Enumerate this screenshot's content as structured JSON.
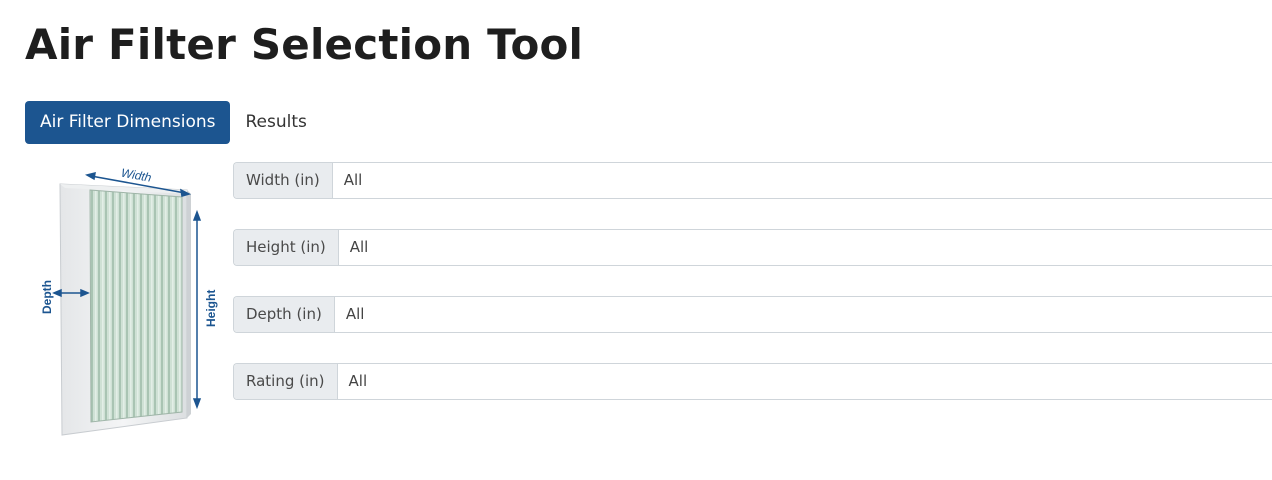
{
  "page": {
    "title": "Air Filter Selection Tool"
  },
  "tabs": [
    {
      "label": "Air Filter Dimensions",
      "active": true
    },
    {
      "label": "Results",
      "active": false
    }
  ],
  "diagram": {
    "width_label": "Width",
    "height_label": "Height",
    "depth_label": "Depth"
  },
  "fields": [
    {
      "label": "Width (in)",
      "value": "All"
    },
    {
      "label": "Height (in)",
      "value": "All"
    },
    {
      "label": "Depth (in)",
      "value": "All"
    },
    {
      "label": "Rating (in)",
      "value": "All"
    }
  ],
  "colors": {
    "accent": "#1c5590",
    "label_bg": "#e9ecef",
    "border": "#cfd5da",
    "filter_media": "#c9ddd0"
  }
}
